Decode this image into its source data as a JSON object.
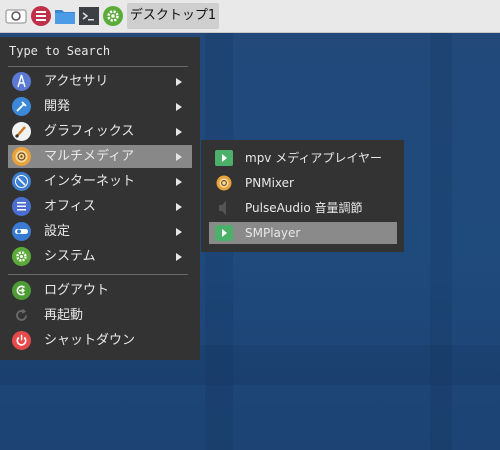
{
  "panel": {
    "workspace_label": "デスクトップ1"
  },
  "menu": {
    "search_placeholder": "Type to Search",
    "items": [
      {
        "label": "アクセサリ",
        "icon": "accessories-icon",
        "has_submenu": true
      },
      {
        "label": "開発",
        "icon": "development-icon",
        "has_submenu": true
      },
      {
        "label": "グラフィックス",
        "icon": "graphics-icon",
        "has_submenu": true
      },
      {
        "label": "マルチメディア",
        "icon": "multimedia-icon",
        "has_submenu": true,
        "active": true
      },
      {
        "label": "インターネット",
        "icon": "internet-icon",
        "has_submenu": true
      },
      {
        "label": "オフィス",
        "icon": "office-icon",
        "has_submenu": true
      },
      {
        "label": "設定",
        "icon": "settings-icon",
        "has_submenu": true
      },
      {
        "label": "システム",
        "icon": "system-icon",
        "has_submenu": true
      }
    ],
    "actions": [
      {
        "label": "ログアウト",
        "icon": "logout-icon"
      },
      {
        "label": "再起動",
        "icon": "restart-icon"
      },
      {
        "label": "シャットダウン",
        "icon": "shutdown-icon"
      }
    ]
  },
  "submenu": {
    "items": [
      {
        "label": "mpv メディアプレイヤー",
        "icon": "mpv-icon"
      },
      {
        "label": "PNMixer",
        "icon": "pnmixer-icon"
      },
      {
        "label": "PulseAudio 音量調節",
        "icon": "speaker-icon"
      },
      {
        "label": "SMPlayer",
        "icon": "smplayer-icon",
        "active": true
      }
    ]
  },
  "colors": {
    "menu_bg": "#333333",
    "highlight": "#888888",
    "desktop": "#21497a"
  }
}
